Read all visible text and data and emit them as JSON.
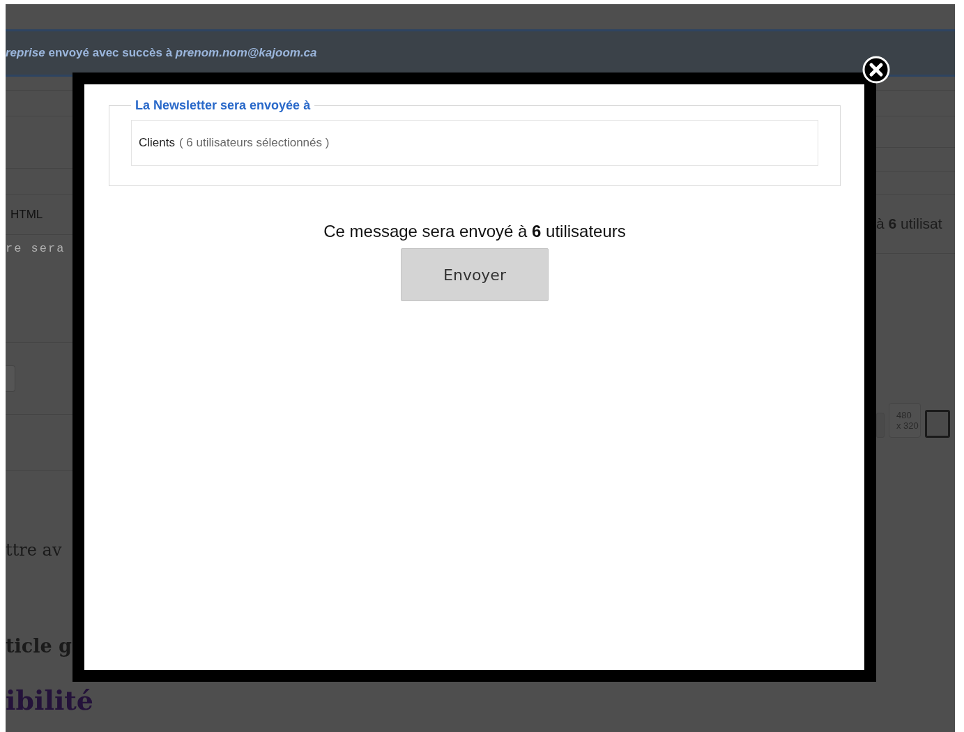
{
  "notice": {
    "text": "*reprise* envoyé avec succès à *prenom.nom@kajoom.ca*"
  },
  "background": {
    "left": [
      {
        "kind": "label",
        "text": "HTML"
      },
      {
        "kind": "code",
        "text": "re sera"
      },
      {
        "kind": "heading",
        "text": "ttre av"
      },
      {
        "kind": "subheading",
        "text": "ticle g"
      },
      {
        "kind": "title",
        "text": "ibilité"
      }
    ],
    "right": {
      "count_text": "à **6** utilisat",
      "size_lines": [
        "480",
        "x 320"
      ]
    }
  },
  "modal": {
    "legend": "La Newsletter sera envoyée à",
    "group": "Clients",
    "detail": "( 6 utilisateurs sélectionnés )",
    "message": "Ce message sera envoyé à **6** utilisateurs",
    "button": "Envoyer"
  }
}
